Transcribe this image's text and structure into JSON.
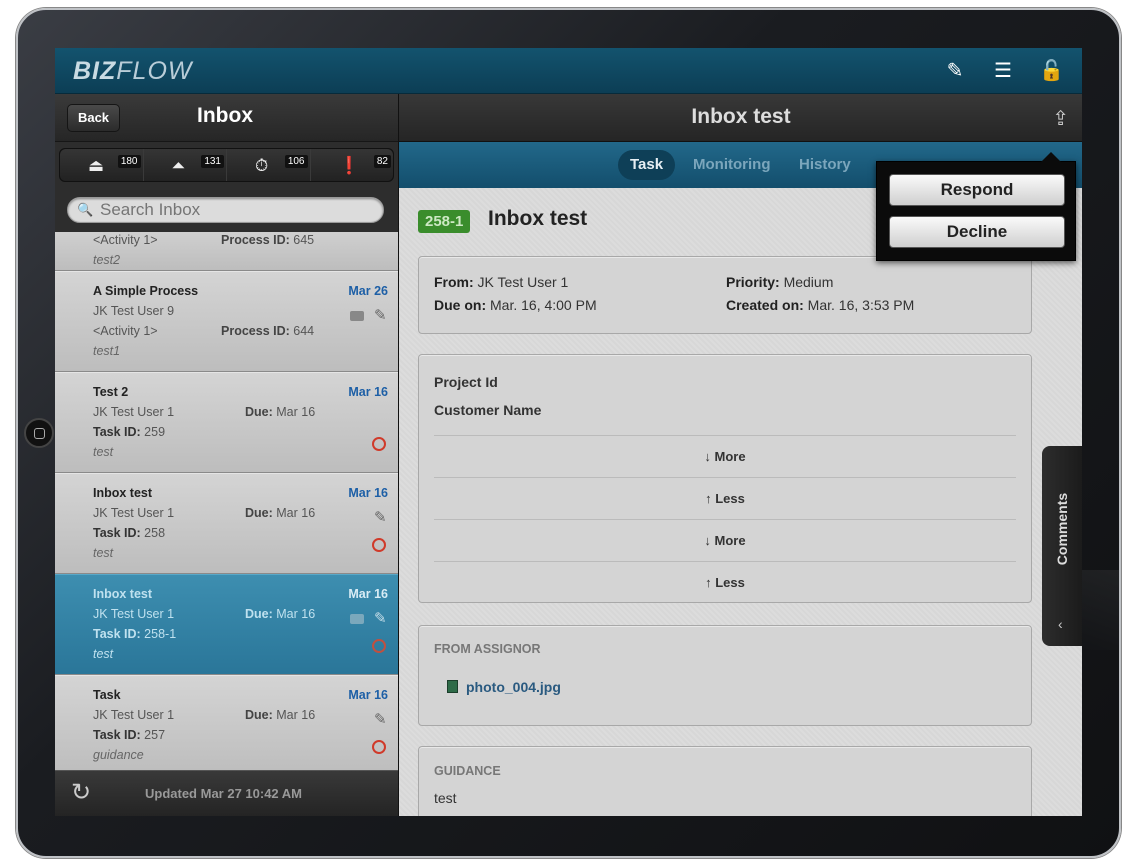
{
  "app": {
    "logo_bold": "BIZ",
    "logo_rest": "FLOW"
  },
  "topbar": {
    "icons": [
      "compose-icon",
      "user-list-icon",
      "unlock-icon"
    ]
  },
  "left": {
    "back_label": "Back",
    "title": "Inbox",
    "filters": [
      {
        "icon": "inbox-tray-icon",
        "count": "180"
      },
      {
        "icon": "outbox-tray-icon",
        "count": "131"
      },
      {
        "icon": "stopwatch-icon",
        "count": "106"
      },
      {
        "icon": "alert-icon",
        "count": "82"
      }
    ],
    "search_placeholder": "Search Inbox",
    "items": [
      {
        "l3": "<Activity 1>",
        "pid_label": "Process ID:",
        "pid": " 645",
        "l4": "test2"
      },
      {
        "title": "A Simple Process",
        "date": "Mar 26",
        "l2": "JK Test User 9",
        "l3": "<Activity 1>",
        "pid_label": "Process ID:",
        "pid": " 644",
        "l4": "test1"
      },
      {
        "title": "Test 2",
        "date": "Mar 16",
        "l2": "JK Test User 1",
        "due_label": "Due:",
        "due": " Mar 16",
        "task_label": "Task ID:",
        "task": " 259",
        "l4": "test"
      },
      {
        "title": "Inbox test",
        "date": "Mar 16",
        "l2": "JK Test User 1",
        "due_label": "Due:",
        "due": " Mar 16",
        "task_label": "Task ID:",
        "task": " 258",
        "l4": "test"
      },
      {
        "title": "Inbox test",
        "date": "Mar 16",
        "l2": "JK Test User 1",
        "due_label": "Due:",
        "due": " Mar 16",
        "task_label": "Task ID:",
        "task": " 258-1",
        "l4": "test"
      },
      {
        "title": "Task",
        "date": "Mar 16",
        "l2": "JK Test User 1",
        "due_label": "Due:",
        "due": " Mar 16",
        "task_label": "Task ID:",
        "task": " 257",
        "l4": "guidance"
      }
    ],
    "updated": "Updated Mar 27 10:42 AM"
  },
  "right": {
    "title": "Inbox test",
    "tabs": [
      "Task",
      "Monitoring",
      "History"
    ],
    "badge": "258-1",
    "task_title": "Inbox test",
    "from_label": "From:",
    "from": " JK Test User 1",
    "priority_label": "Priority:",
    "priority": " Medium",
    "due_label": "Due on:",
    "due": " Mar. 16, 4:00 PM",
    "created_label": "Created on:",
    "created": " Mar. 16, 3:53 PM",
    "fields": [
      "Project Id",
      "Customer Name"
    ],
    "toggles": [
      "↓ More",
      "↑ Less",
      "↓ More",
      "↑ Less"
    ],
    "assignor_head": "FROM ASSIGNOR",
    "attachment": "photo_004.jpg",
    "guidance_head": "GUIDANCE",
    "guidance": "test",
    "comments": "Comments",
    "comments_arrow": "‹"
  },
  "popover": {
    "respond": "Respond",
    "decline": "Decline"
  }
}
